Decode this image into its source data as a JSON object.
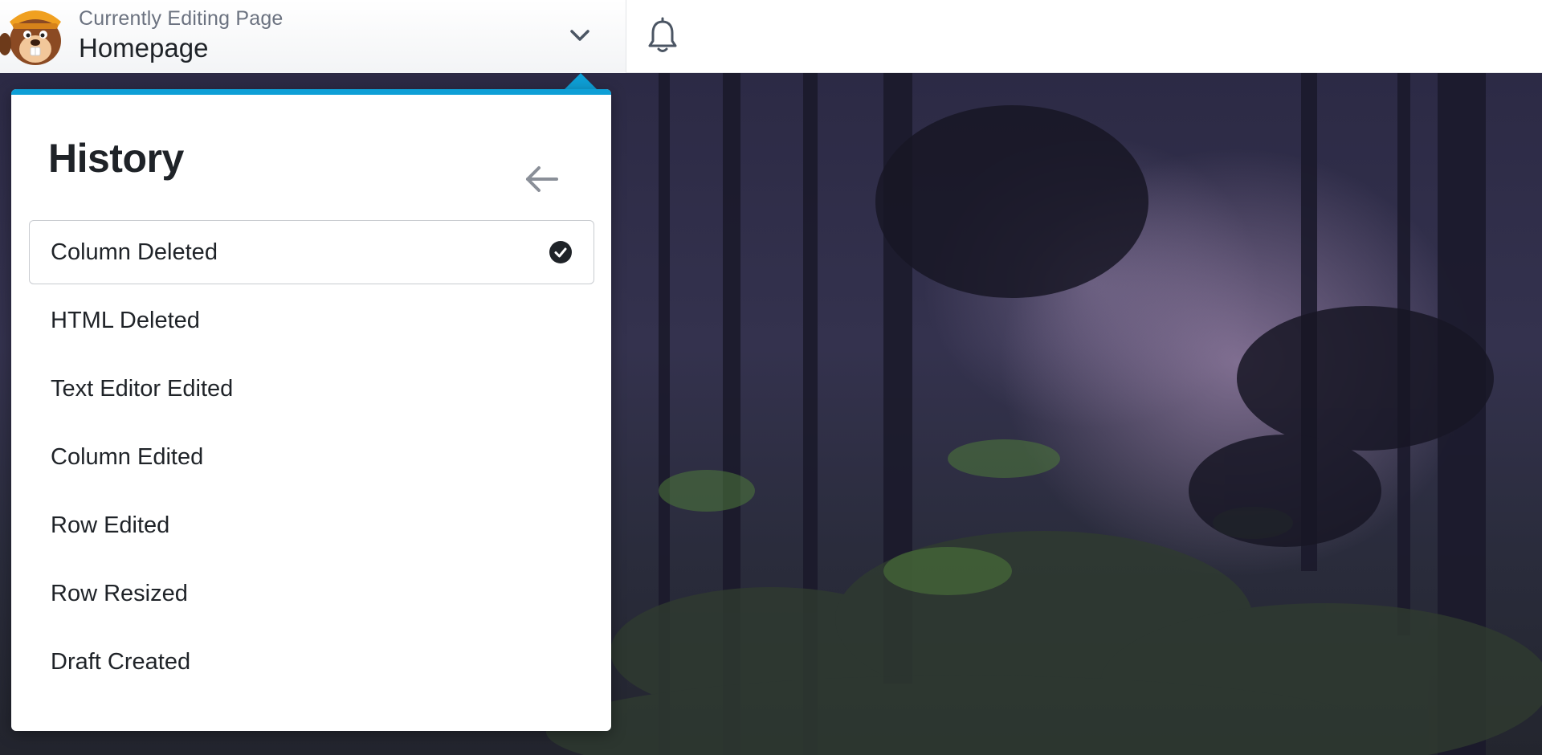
{
  "header": {
    "editing_label": "Currently Editing Page",
    "page_title": "Homepage",
    "icons": [
      "beaver-logo-icon",
      "chevron-down-icon",
      "bell-icon"
    ]
  },
  "history_panel": {
    "heading": "History",
    "back_icon": "arrow-left-icon",
    "items": [
      {
        "label": "Column Deleted",
        "active": true
      },
      {
        "label": "HTML Deleted",
        "active": false
      },
      {
        "label": "Text Editor Edited",
        "active": false
      },
      {
        "label": "Column Edited",
        "active": false
      },
      {
        "label": "Row Edited",
        "active": false
      },
      {
        "label": "Row Resized",
        "active": false
      },
      {
        "label": "Draft Created",
        "active": false
      }
    ]
  },
  "colors": {
    "accent": "#0e9fd6",
    "text": "#1f2328",
    "muted": "#6b7280"
  }
}
